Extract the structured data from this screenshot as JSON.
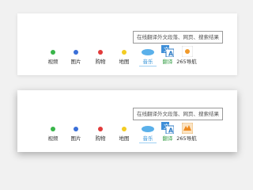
{
  "panels": [
    {
      "tooltip": "在线翻译外文段落、网页、搜索结果",
      "nav": [
        {
          "label": "视频",
          "dot_color": "#39b54a"
        },
        {
          "label": "图片",
          "dot_color": "#3a6fd8"
        },
        {
          "label": "购物",
          "dot_color": "#e23b3b"
        },
        {
          "label": "地图",
          "dot_color": "#f3cc22"
        },
        {
          "label": "音乐",
          "icon": "music-oval"
        },
        {
          "label": "翻译",
          "icon": "translate-icon"
        },
        {
          "label": "265导航",
          "icon": "site-icon"
        }
      ]
    },
    {
      "tooltip": "在线翻译外文段落、网页、搜索结果",
      "nav": [
        {
          "label": "视频",
          "dot_color": "#39b54a"
        },
        {
          "label": "图片",
          "dot_color": "#3a6fd8"
        },
        {
          "label": "购物",
          "dot_color": "#e23b3b"
        },
        {
          "label": "地图",
          "dot_color": "#f3cc22"
        },
        {
          "label": "音乐",
          "icon": "music-oval"
        },
        {
          "label": "翻译",
          "icon": "translate-icon"
        },
        {
          "label": "265导航",
          "icon": "site-icon"
        }
      ]
    }
  ]
}
